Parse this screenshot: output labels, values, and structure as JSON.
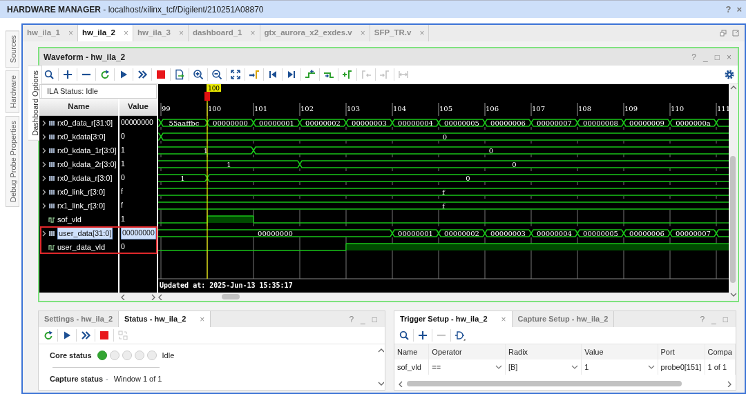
{
  "window": {
    "title": "**HARDWARE MANAGER** - localhost/xilinx_tcf/Digilent/210251A08870",
    "buttons": [
      "?",
      "×"
    ]
  },
  "side_tabs": [
    {
      "label": "Sources"
    },
    {
      "label": "Hardware"
    },
    {
      "label": "Debug Probe Properties"
    }
  ],
  "editor_tabs": [
    {
      "label": "hw_ila_1",
      "selected": false,
      "close": "×"
    },
    {
      "label": "hw_ila_2",
      "selected": true,
      "close": "×"
    },
    {
      "label": "hw_ila_3",
      "selected": false,
      "close": "×"
    },
    {
      "label": "dashboard_1",
      "selected": false,
      "close": "×"
    },
    {
      "label": "gtx_aurora_x2_exdes.v",
      "selected": false,
      "close": "×"
    },
    {
      "label": "SFP_TR.v",
      "selected": false,
      "close": "×"
    }
  ],
  "dashboard_tab": {
    "label": "Dashboard Options"
  },
  "waveform": {
    "title": "Waveform - hw_ila_2",
    "window_buttons": [
      "?",
      "_",
      "□",
      "×"
    ],
    "toolbar": [
      {
        "kind": "search",
        "disabled": false
      },
      {
        "kind": "add",
        "disabled": false
      },
      {
        "kind": "remove",
        "disabled": false
      },
      {
        "kind": "refresh",
        "disabled": false
      },
      {
        "kind": "run",
        "disabled": false
      },
      {
        "kind": "run_now",
        "disabled": false
      },
      {
        "kind": "stop",
        "disabled": false
      },
      {
        "kind": "export",
        "disabled": false
      },
      {
        "kind": "zoom_in",
        "disabled": false
      },
      {
        "kind": "zoom_out",
        "disabled": false
      },
      {
        "kind": "zoom_fit",
        "disabled": false
      },
      {
        "kind": "goto_cursor",
        "disabled": false
      },
      {
        "kind": "go_start",
        "disabled": false
      },
      {
        "kind": "go_end",
        "disabled": false
      },
      {
        "kind": "prev_edge",
        "disabled": false
      },
      {
        "kind": "next_edge",
        "disabled": false
      },
      {
        "kind": "add_marker",
        "disabled": false
      },
      {
        "kind": "prev_marker",
        "disabled": true
      },
      {
        "kind": "next_marker",
        "disabled": true
      },
      {
        "kind": "swap_markers",
        "disabled": true
      },
      {
        "kind": "settings",
        "disabled": false
      }
    ],
    "ila_status": "ILA Status:  Idle",
    "columns": [
      "Name",
      "Value"
    ],
    "ruler": {
      "cursor_label": "100",
      "ticks": [
        {
          "label": "99",
          "cursor": false
        },
        {
          "label": "100",
          "cursor": true
        },
        {
          "label": "101",
          "cursor": false
        },
        {
          "label": "102",
          "cursor": false
        },
        {
          "label": "103",
          "cursor": false
        },
        {
          "label": "104",
          "cursor": false
        },
        {
          "label": "105",
          "cursor": false
        },
        {
          "label": "106",
          "cursor": false
        },
        {
          "label": "107",
          "cursor": false
        },
        {
          "label": "108",
          "cursor": false
        },
        {
          "label": "109",
          "cursor": false
        },
        {
          "label": "110",
          "cursor": false
        },
        {
          "label": "111",
          "cursor": false
        }
      ]
    },
    "signals": [
      {
        "name": "rx0_data_r[31:0]",
        "value": "00000000",
        "kind": "bus",
        "selected": false,
        "boxed": false,
        "cycles": [
          {
            "change": true,
            "label": "55aaffbc"
          },
          {
            "change": true,
            "label": "00000000"
          },
          {
            "change": true,
            "label": "00000001"
          },
          {
            "change": true,
            "label": "00000002"
          },
          {
            "change": true,
            "label": "00000003"
          },
          {
            "change": true,
            "label": "00000004"
          },
          {
            "change": true,
            "label": "00000005"
          },
          {
            "change": true,
            "label": "00000006"
          },
          {
            "change": true,
            "label": "00000007"
          },
          {
            "change": true,
            "label": "00000008"
          },
          {
            "change": true,
            "label": "00000009"
          },
          {
            "change": true,
            "label": "0000000a"
          },
          {
            "change": true
          }
        ]
      },
      {
        "name": "rx0_kdata[3:0]",
        "value": "0",
        "kind": "bus",
        "selected": false,
        "boxed": false,
        "cycles": [
          {
            "change": true,
            "label": "0"
          },
          {
            "change": false
          },
          {
            "change": false
          },
          {
            "change": false
          },
          {
            "change": false
          },
          {
            "change": false
          },
          {
            "change": false
          },
          {
            "change": false
          },
          {
            "change": false
          },
          {
            "change": false
          },
          {
            "change": false
          },
          {
            "change": false
          },
          {
            "change": false
          }
        ]
      },
      {
        "name": "rx0_kdata_1r[3:0]",
        "value": "1",
        "kind": "bus",
        "selected": false,
        "boxed": false,
        "cycles": [
          {
            "change": false,
            "label": "1"
          },
          {
            "change": false
          },
          {
            "change": true,
            "label": "0"
          },
          {
            "change": false
          },
          {
            "change": false
          },
          {
            "change": false
          },
          {
            "change": false
          },
          {
            "change": false
          },
          {
            "change": false
          },
          {
            "change": false
          },
          {
            "change": false
          },
          {
            "change": false
          },
          {
            "change": false
          }
        ]
      },
      {
        "name": "rx0_kdata_2r[3:0]",
        "value": "1",
        "kind": "bus",
        "selected": false,
        "boxed": false,
        "cycles": [
          {
            "change": false,
            "label": "1"
          },
          {
            "change": false
          },
          {
            "change": false
          },
          {
            "change": true,
            "label": "0"
          },
          {
            "change": false
          },
          {
            "change": false
          },
          {
            "change": false
          },
          {
            "change": false
          },
          {
            "change": false
          },
          {
            "change": false
          },
          {
            "change": false
          },
          {
            "change": false
          },
          {
            "change": false
          }
        ]
      },
      {
        "name": "rx0_kdata_r[3:0]",
        "value": "0",
        "kind": "bus",
        "selected": false,
        "boxed": false,
        "cycles": [
          {
            "change": false,
            "label": "1"
          },
          {
            "change": true,
            "label": "0"
          },
          {
            "change": false
          },
          {
            "change": false
          },
          {
            "change": false
          },
          {
            "change": false
          },
          {
            "change": false
          },
          {
            "change": false
          },
          {
            "change": false
          },
          {
            "change": false
          },
          {
            "change": false
          },
          {
            "change": false
          },
          {
            "change": false
          }
        ]
      },
      {
        "name": "rx0_link_r[3:0]",
        "value": "f",
        "kind": "bus",
        "selected": false,
        "boxed": false,
        "cycles": [
          {
            "change": false,
            "label": "f"
          },
          {
            "change": false
          },
          {
            "change": false
          },
          {
            "change": false
          },
          {
            "change": false
          },
          {
            "change": false
          },
          {
            "change": false
          },
          {
            "change": false
          },
          {
            "change": false
          },
          {
            "change": false
          },
          {
            "change": false
          },
          {
            "change": false
          },
          {
            "change": false
          }
        ]
      },
      {
        "name": "rx1_link_r[3:0]",
        "value": "f",
        "kind": "bus",
        "selected": false,
        "boxed": false,
        "cycles": [
          {
            "change": false,
            "label": "f"
          },
          {
            "change": false
          },
          {
            "change": false
          },
          {
            "change": false
          },
          {
            "change": false
          },
          {
            "change": false
          },
          {
            "change": false
          },
          {
            "change": false
          },
          {
            "change": false
          },
          {
            "change": false
          },
          {
            "change": false
          },
          {
            "change": false
          },
          {
            "change": false
          }
        ]
      },
      {
        "name": "sof_vld",
        "value": "1",
        "kind": "bit",
        "selected": false,
        "boxed": false,
        "cycles": [
          {
            "high": false
          },
          {
            "high": true
          },
          {
            "high": false
          },
          {
            "high": false
          },
          {
            "high": false
          },
          {
            "high": false
          },
          {
            "high": false
          },
          {
            "high": false
          },
          {
            "high": false
          },
          {
            "high": false
          },
          {
            "high": false
          },
          {
            "high": false
          },
          {
            "high": false
          }
        ]
      },
      {
        "name": "user_data[31:0]",
        "value": "00000000",
        "kind": "bus",
        "selected": true,
        "boxed": true,
        "cycles": [
          {
            "change": false,
            "label": "00000000"
          },
          {
            "change": false
          },
          {
            "change": false
          },
          {
            "change": false
          },
          {
            "change": false
          },
          {
            "change": true,
            "label": "00000001"
          },
          {
            "change": true,
            "label": "00000002"
          },
          {
            "change": true,
            "label": "00000003"
          },
          {
            "change": true,
            "label": "00000004"
          },
          {
            "change": true,
            "label": "00000005"
          },
          {
            "change": true,
            "label": "00000006"
          },
          {
            "change": true,
            "label": "00000007"
          },
          {
            "change": true
          }
        ]
      },
      {
        "name": "user_data_vld",
        "value": "0",
        "kind": "bit",
        "selected": false,
        "boxed": true,
        "cycles": [
          {
            "high": false
          },
          {
            "high": false
          },
          {
            "high": false
          },
          {
            "high": false
          },
          {
            "high": true
          },
          {
            "high": true
          },
          {
            "high": true
          },
          {
            "high": true
          },
          {
            "high": true
          },
          {
            "high": true
          },
          {
            "high": true
          },
          {
            "high": true
          },
          {
            "high": true
          }
        ]
      }
    ],
    "updated": "Updated at: 2025-Jun-13 15:35:17"
  },
  "status_panel": {
    "tabs": [
      {
        "label": "Settings - hw_ila_2",
        "selected": false
      },
      {
        "label": "Status - hw_ila_2",
        "selected": true,
        "close": "×"
      }
    ],
    "window_buttons": [
      "?",
      "_",
      "□"
    ],
    "toolbar": [
      {
        "kind": "refresh",
        "disabled": false
      },
      {
        "kind": "run",
        "disabled": false
      },
      {
        "kind": "run_now",
        "disabled": false
      },
      {
        "kind": "stop",
        "disabled": false
      },
      {
        "kind": "toggle",
        "disabled": true
      }
    ],
    "core_status": {
      "label": "Core status",
      "lights": [
        {
          "on": true
        },
        {
          "on": false
        },
        {
          "on": false
        },
        {
          "on": false
        },
        {
          "on": false
        }
      ],
      "state": "Idle"
    },
    "capture_status": {
      "label": "Capture status",
      "separator": "-",
      "value": "Window 1 of 1"
    }
  },
  "trigger_panel": {
    "tabs": [
      {
        "label": "Trigger Setup - hw_ila_2",
        "selected": true,
        "close": "×"
      },
      {
        "label": "Capture Setup - hw_ila_2",
        "selected": false
      }
    ],
    "window_buttons": [
      "?",
      "_",
      "□"
    ],
    "toolbar": [
      {
        "kind": "search",
        "disabled": false
      },
      {
        "kind": "add",
        "disabled": false
      },
      {
        "kind": "remove",
        "disabled": true
      },
      {
        "kind": "trigger_gate",
        "disabled": false
      }
    ],
    "columns": [
      "Name",
      "Operator",
      "Radix",
      "Value",
      "Port",
      "Compa"
    ],
    "rows": [
      {
        "name": "sof_vld",
        "operator": "==",
        "radix": "[B]",
        "value": "1",
        "port": "probe0[151]",
        "compare": "1 of 1"
      }
    ]
  }
}
